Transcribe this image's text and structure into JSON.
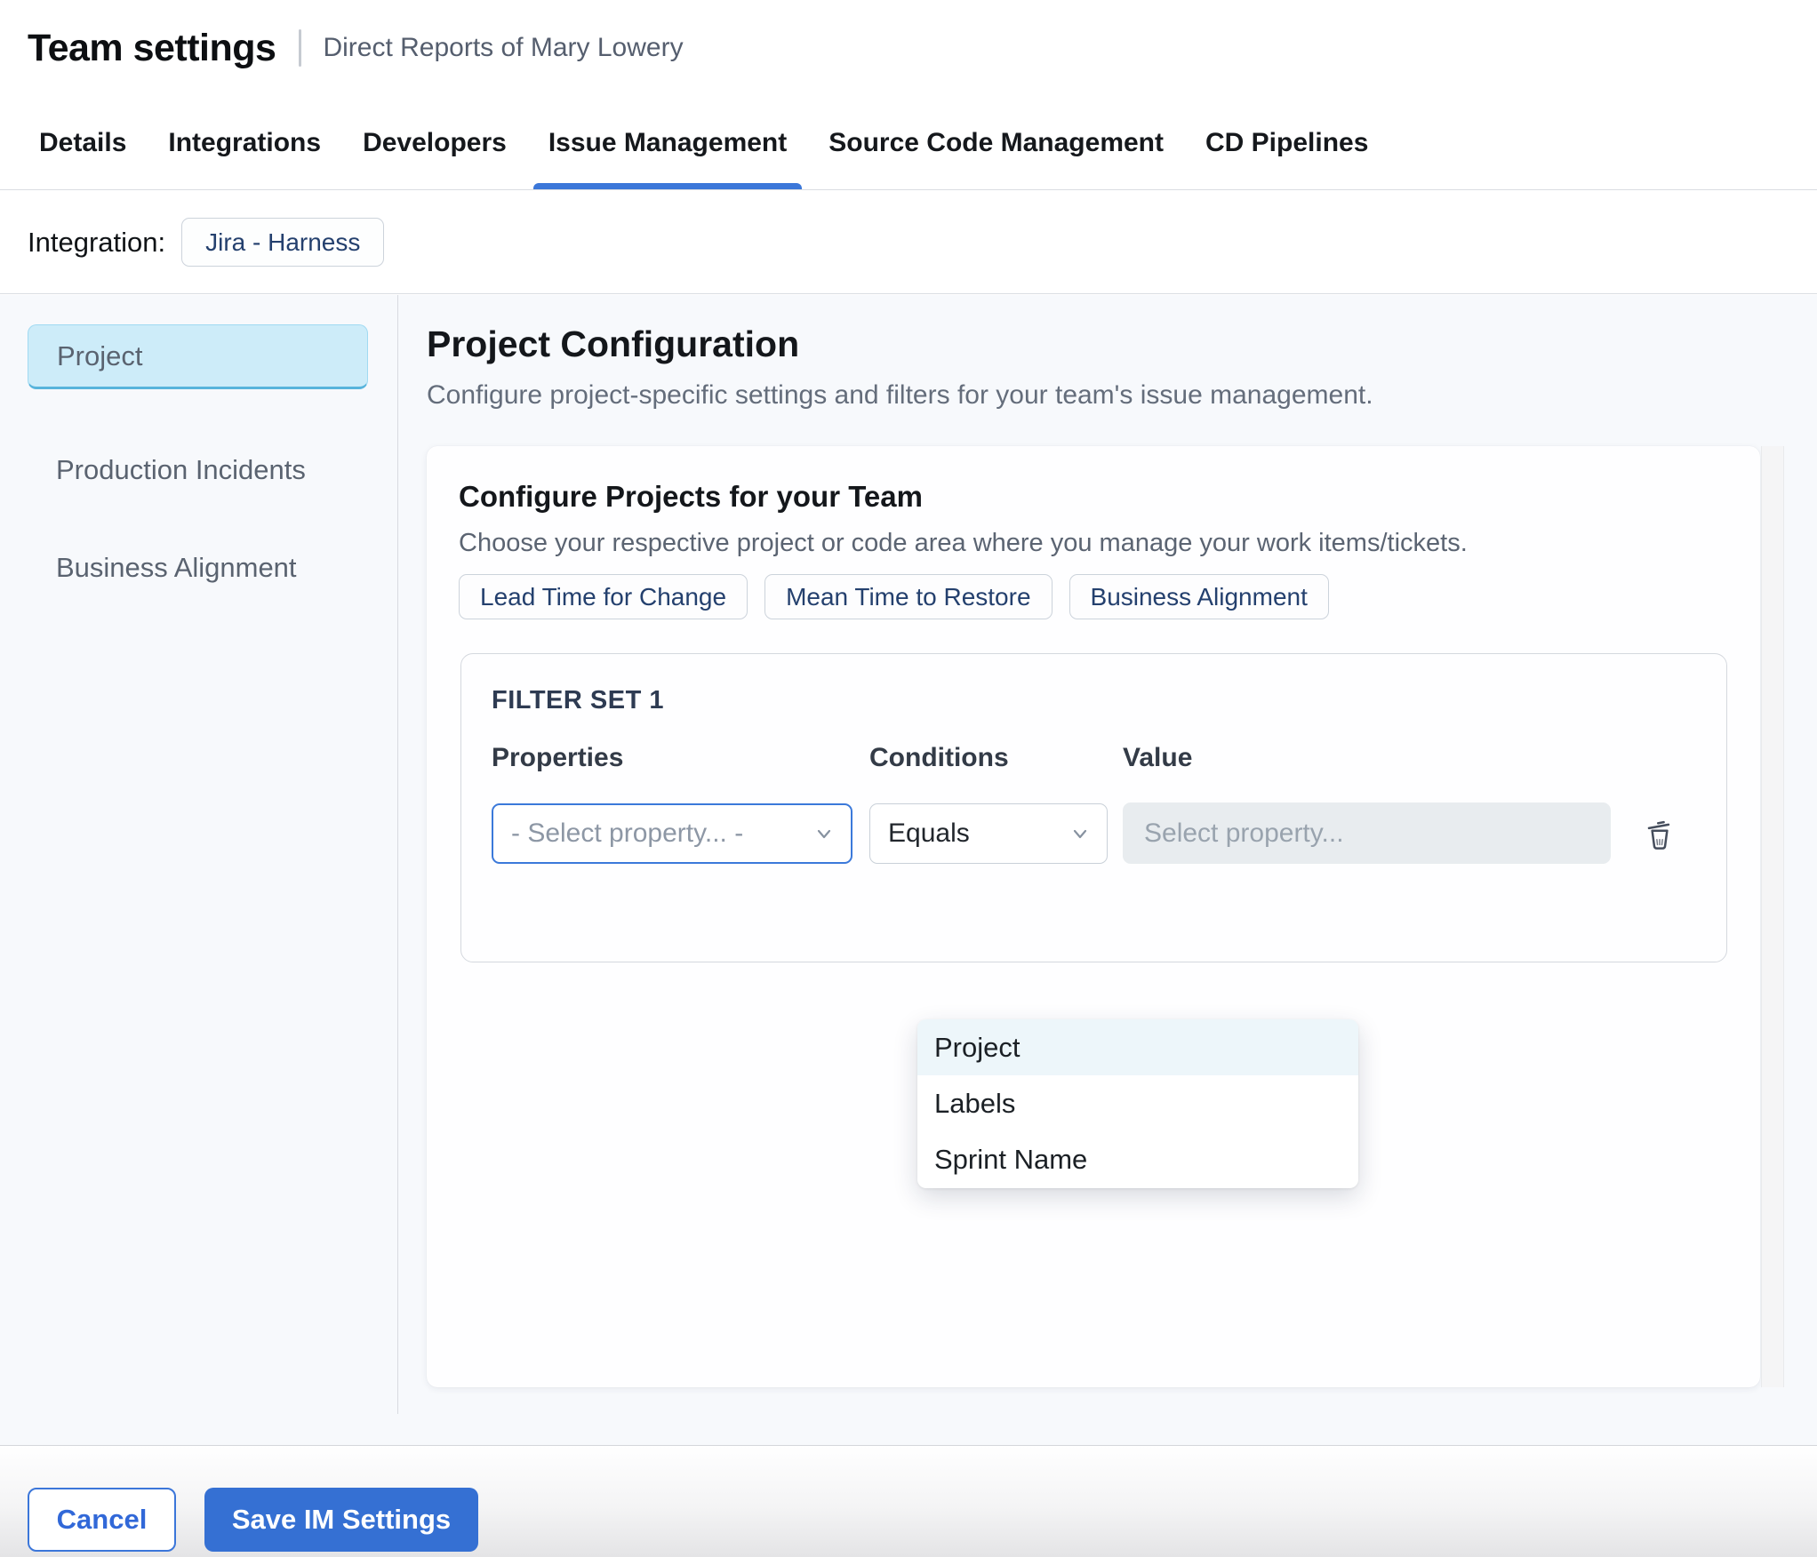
{
  "header": {
    "title": "Team settings",
    "subtitle": "Direct Reports of Mary Lowery"
  },
  "tabs": [
    {
      "label": "Details",
      "active": false
    },
    {
      "label": "Integrations",
      "active": false
    },
    {
      "label": "Developers",
      "active": false
    },
    {
      "label": "Issue Management",
      "active": true
    },
    {
      "label": "Source Code Management",
      "active": false
    },
    {
      "label": "CD Pipelines",
      "active": false
    }
  ],
  "integration": {
    "label": "Integration:",
    "value": "Jira - Harness"
  },
  "sidebar": {
    "items": [
      {
        "label": "Project",
        "selected": true
      },
      {
        "label": "Production Incidents",
        "selected": false
      },
      {
        "label": "Business Alignment",
        "selected": false
      }
    ]
  },
  "main": {
    "title": "Project Configuration",
    "description": "Configure project-specific settings and filters for your team's issue management.",
    "card": {
      "title": "Configure Projects for your Team",
      "description": "Choose your respective project or code area where you manage your work items/tickets.",
      "chips": [
        "Lead Time for Change",
        "Mean Time to Restore",
        "Business Alignment"
      ],
      "filter_set": {
        "title": "FILTER SET 1",
        "columns": [
          "Properties",
          "Conditions",
          "Value"
        ],
        "property_placeholder": "- Select property... -",
        "condition_value": "Equals",
        "value_placeholder": "Select property...",
        "dropdown_options": [
          "Project",
          "Labels",
          "Sprint Name"
        ],
        "dropdown_highlighted": "Project"
      }
    }
  },
  "footer": {
    "cancel_label": "Cancel",
    "save_label": "Save IM Settings"
  },
  "colors": {
    "accent_blue": "#3b77d9",
    "save_button_blue": "#3570d3",
    "selected_sidebar_bg": "#cdecf9",
    "chip_text_navy": "#24406e",
    "dropdown_highlight": "#edf6fa",
    "content_background": "#f7f9fc",
    "value_input_bg": "#e8ecef"
  }
}
